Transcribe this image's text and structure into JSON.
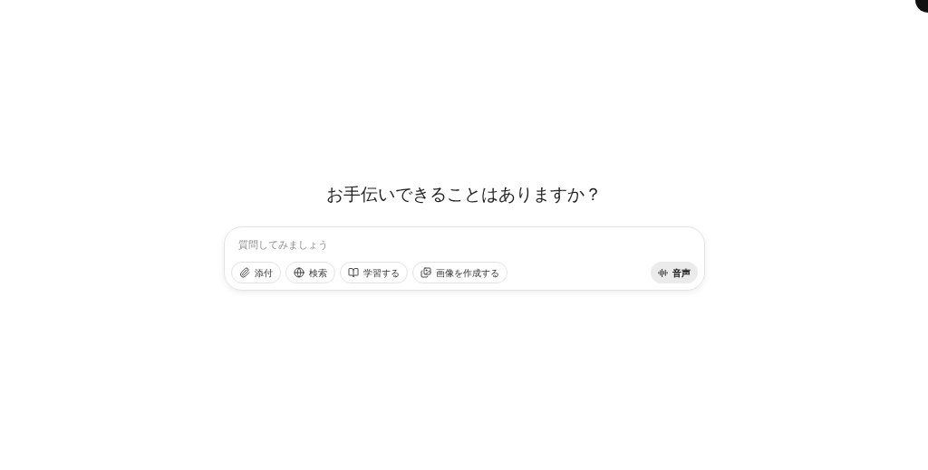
{
  "heading": "お手伝いできることはありますか？",
  "composer": {
    "placeholder": "質問してみましょう",
    "tools": [
      {
        "kind": "attach",
        "label": "添付"
      },
      {
        "kind": "search",
        "label": "検索"
      },
      {
        "kind": "study",
        "label": "学習する"
      },
      {
        "kind": "image",
        "label": "画像を作成する"
      }
    ],
    "voice": {
      "label": "音声"
    }
  }
}
